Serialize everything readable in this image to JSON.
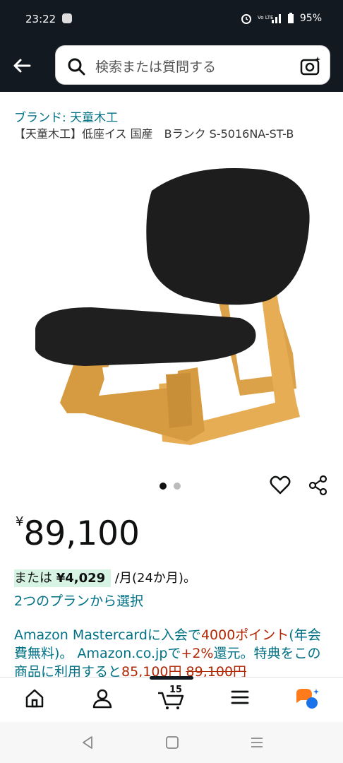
{
  "status": {
    "time": "23:22",
    "battery": "95%",
    "icons": [
      "alarm-icon",
      "volte-icon",
      "signal-icon",
      "battery-icon"
    ]
  },
  "search": {
    "placeholder": "検索または質問する"
  },
  "product": {
    "brand": "ブランド: 天童木工",
    "title": "【天童木工】低座イス 国産　Bランク S-5016NA-ST-B",
    "image_dots": 2,
    "active_dot": 0
  },
  "price": {
    "currency": "¥",
    "amount": "89,100"
  },
  "installment": {
    "prefix": "または ",
    "amount": "¥4,029",
    "suffix": " /月(24か月)。"
  },
  "plans_link": "2つのプランから選択",
  "promo": {
    "part1": "Amazon Mastercardに入会で",
    "points": "4000ポイント",
    "part2": "(年会費無料)。 Amazon.co.jpで",
    "rate": "+2%",
    "part3": "還元。特典をこの商品に利用すると",
    "after_price": "85,100円",
    "orig_price": "89,100円"
  },
  "bottom_nav": {
    "cart_count": "15",
    "items": [
      "home-icon",
      "account-icon",
      "cart-icon",
      "menu-icon",
      "rufus-icon"
    ]
  },
  "colors": {
    "header_bg": "#131921",
    "link": "#007185",
    "deal_red": "#b12704",
    "install_hl": "#d7f3e3"
  }
}
